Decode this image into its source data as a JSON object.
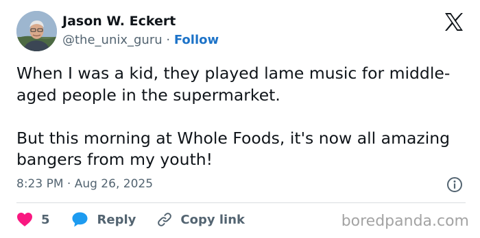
{
  "author": {
    "name": "Jason W. Eckert",
    "handle": "@the_unix_guru",
    "separator": "·",
    "follow_label": "Follow"
  },
  "tweet": {
    "paragraphs": [
      "When I was a kid, they played lame music for middle-aged people in the supermarket.",
      "But this morning at Whole Foods, it's now all amazing bangers from my youth!"
    ],
    "timestamp": "8:23 PM · Aug 26, 2025"
  },
  "actions": {
    "like_count": "5",
    "reply_label": "Reply",
    "copy_link_label": "Copy link"
  },
  "icons": {
    "platform": "x-logo-icon",
    "info": "info-icon",
    "like": "heart-icon",
    "reply": "speech-bubble-icon",
    "copy": "link-icon"
  },
  "colors": {
    "like": "#f91880",
    "reply": "#1d9bf0",
    "follow": "#1d73c8",
    "secondary_text": "#536471"
  },
  "watermark": "boredpanda.com"
}
